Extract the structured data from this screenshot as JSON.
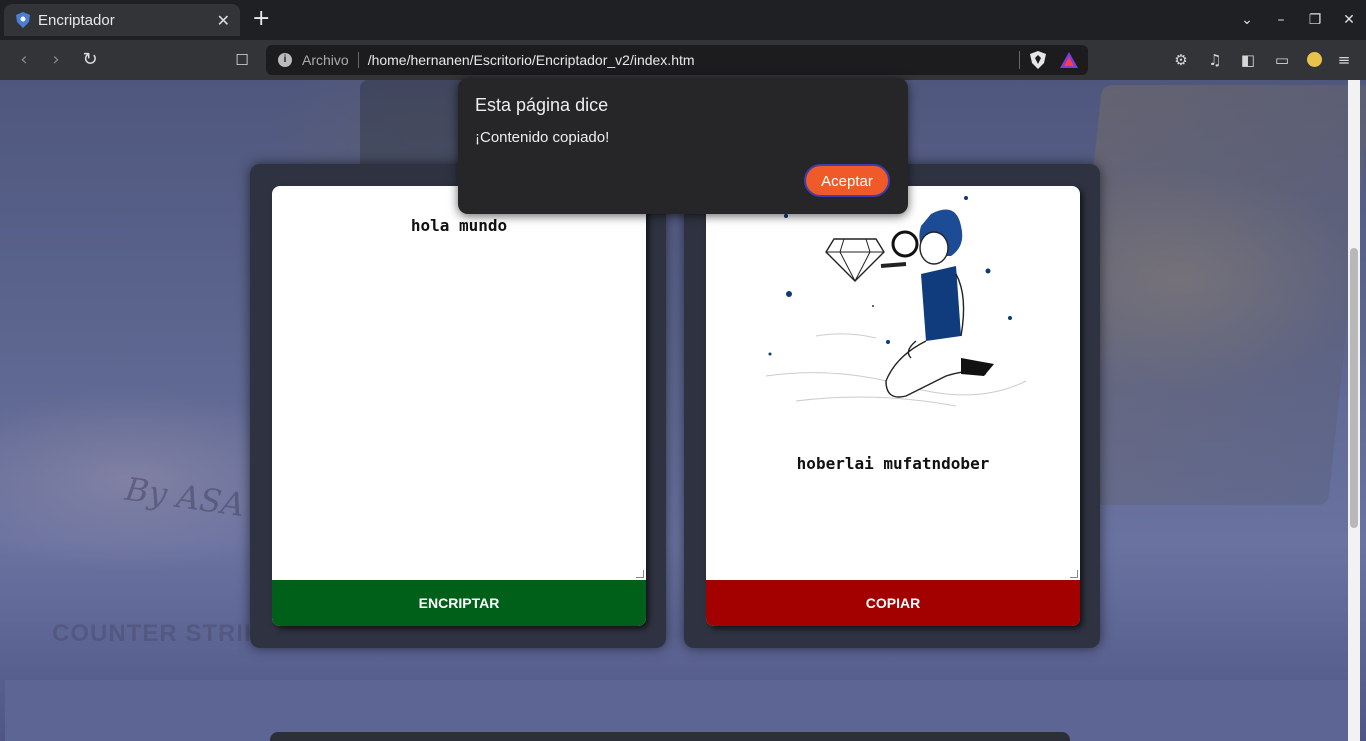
{
  "browser": {
    "tab_title": "Encriptador",
    "tab_close": "✕",
    "new_tab": "+",
    "url_prefix": "Archivo",
    "url": "/home/hernanen/Escritorio/Encriptador_v2/index.htm",
    "window_controls": [
      "⌄",
      "–",
      "❐",
      "✕"
    ]
  },
  "page": {
    "background_text": "By ASA",
    "background_logo_text": "COUNTER STRIKE",
    "input_text": "hola mundo",
    "encrypt_button": "ENCRIPTAR",
    "output_text": "hoberlai mufatndober",
    "copy_button": "COPIAR",
    "colors": {
      "encrypt_button": "#006019",
      "copy_button": "#a30000",
      "panel": "#2f3341"
    }
  },
  "dialog": {
    "title": "Esta página dice",
    "message": "¡Contenido copiado!",
    "ok_button": "Aceptar"
  }
}
